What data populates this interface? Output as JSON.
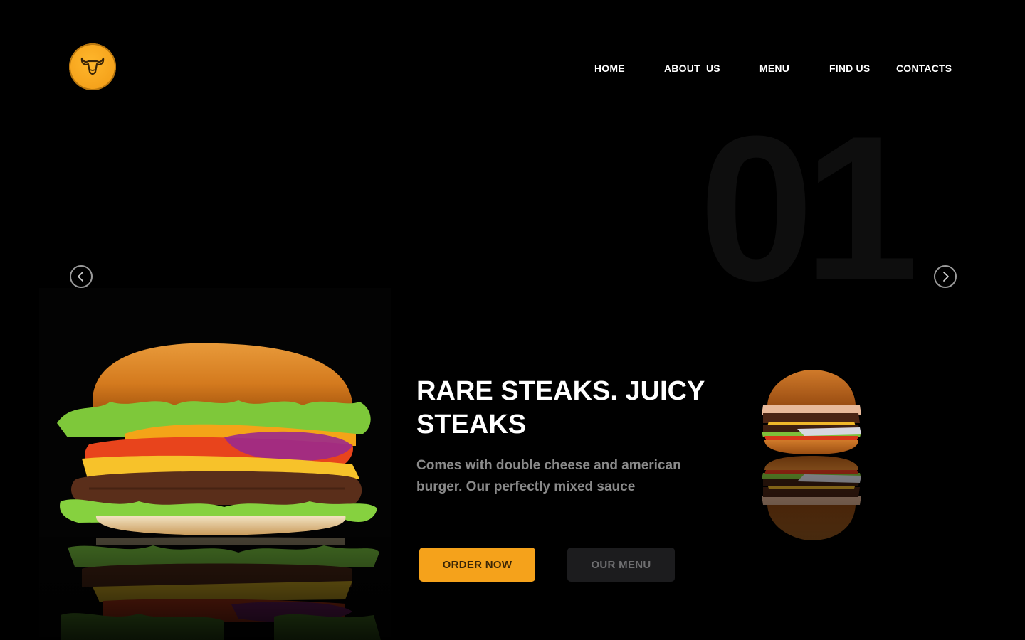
{
  "logo": {
    "icon": "bull-head-icon",
    "color": "#f5a21b"
  },
  "nav": {
    "items": [
      {
        "label": "HOME"
      },
      {
        "label": "ABOUT  US"
      },
      {
        "label": "MENU"
      },
      {
        "label": "FIND US"
      },
      {
        "label": "CONTACTS"
      }
    ]
  },
  "slider": {
    "index_label": "01",
    "prev_icon": "chevron-left-icon",
    "next_icon": "chevron-right-icon"
  },
  "hero": {
    "headline": "RARE STEAKS. JUICY STEAKS",
    "description": "Comes with double cheese and american burger. Our perfectly mixed sauce",
    "order_button": "ORDER NOW",
    "menu_button": "OUR MENU"
  },
  "colors": {
    "accent": "#f5a21b",
    "background": "#000000",
    "secondary_button": "#1c1c1e"
  }
}
